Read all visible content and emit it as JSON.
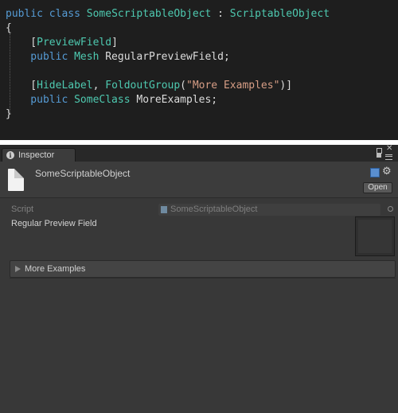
{
  "code": {
    "lines": [
      [
        {
          "t": "public ",
          "c": "kw"
        },
        {
          "t": "class ",
          "c": "kw"
        },
        {
          "t": "SomeScriptableObject",
          "c": "ty"
        },
        {
          "t": " : ",
          "c": "pl"
        },
        {
          "t": "ScriptableObject",
          "c": "ty"
        }
      ],
      [
        {
          "t": "{",
          "c": "pl"
        }
      ],
      [
        {
          "t": "    [",
          "c": "pl"
        },
        {
          "t": "PreviewField",
          "c": "ty"
        },
        {
          "t": "]",
          "c": "pl"
        }
      ],
      [
        {
          "t": "    public ",
          "c": "kw"
        },
        {
          "t": "Mesh",
          "c": "ty"
        },
        {
          "t": " RegularPreviewField;",
          "c": "pl"
        }
      ],
      [],
      [
        {
          "t": "    [",
          "c": "pl"
        },
        {
          "t": "HideLabel",
          "c": "ty"
        },
        {
          "t": ", ",
          "c": "pl"
        },
        {
          "t": "FoldoutGroup",
          "c": "ty"
        },
        {
          "t": "(",
          "c": "pl"
        },
        {
          "t": "\"More Examples\"",
          "c": "st"
        },
        {
          "t": ")]",
          "c": "pl"
        }
      ],
      [
        {
          "t": "    public ",
          "c": "kw"
        },
        {
          "t": "SomeClass",
          "c": "ty"
        },
        {
          "t": " MoreExamples;",
          "c": "pl"
        }
      ],
      [
        {
          "t": "}",
          "c": "pl"
        }
      ]
    ]
  },
  "inspector": {
    "tab_label": "Inspector",
    "asset_name": "SomeScriptableObject",
    "open_button": "Open",
    "script_label": "Script",
    "script_value": "SomeScriptableObject",
    "preview_label": "Regular Preview Field",
    "foldout_label": "More Examples"
  },
  "colors": {
    "keyword": "#569cd6",
    "type": "#4ec9b0",
    "string": "#d69d85",
    "plain": "#dcdcdc",
    "code_bg": "#1e1e1e",
    "inspector_bg": "#383838"
  }
}
